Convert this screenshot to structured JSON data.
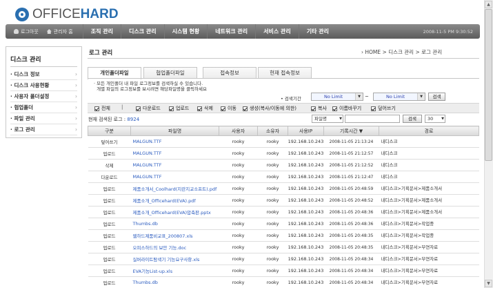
{
  "logo": {
    "part1": "OFFICE",
    "part2": "HARD"
  },
  "topnav": {
    "utils": [
      {
        "label": "로그아웃"
      },
      {
        "label": "관리자 홈"
      }
    ],
    "menu": [
      "조직 관리",
      "디스크 관리",
      "시스템 현황",
      "네트워크 관리",
      "서비스 관리",
      "기타 관리"
    ],
    "datetime": "2008-11-5 PM 9:30:52"
  },
  "sidebar": {
    "title": "디스크 관리",
    "items": [
      {
        "label": "· 디스크 정보",
        "arrow": "›"
      },
      {
        "label": "· 디스크 사용현황",
        "arrow": "›"
      },
      {
        "label": "· 사용자 폴더설정",
        "arrow": "›"
      },
      {
        "label": "· 협업폴더",
        "arrow": "›"
      },
      {
        "label": "· 파일 관리",
        "arrow": "›"
      },
      {
        "label": "· 로그 관리",
        "arrow": "›"
      }
    ]
  },
  "content": {
    "title": "로그 관리",
    "breadcrumb": "› HOME > 디스크 관리 > 로그 관리"
  },
  "tabs": [
    "개인폴더파일",
    "협업폴더파일",
    "접속정보",
    "현재 접속정보"
  ],
  "description": "· 모든 개인폴더 내 파일 로그정보를 검색하실 수 있습니다.\n  개별 파일의 로그정보를 보시려면 해당파일명을 클릭하세요",
  "period": {
    "label": "• 검색기간",
    "from": "No Limit",
    "tilde": "~",
    "to": "No Limit",
    "search_button": "검색"
  },
  "filters": {
    "all": "전체",
    "separator": "|",
    "items": [
      "다운로드",
      "업로드",
      "삭제",
      "이동",
      "생성(복사/이동에 의한)",
      "복사",
      "이름바꾸기",
      "덮어쓰기"
    ]
  },
  "results": {
    "count_label": "현재 검색된 로그 : ",
    "count_value": "8924",
    "filter_field": "파일명",
    "filter_field_arrow": "▼",
    "search_button": "검색",
    "page_size": "30",
    "page_size_arrow": "▼"
  },
  "table": {
    "headers": [
      "구분",
      "파일명",
      "사용자",
      "소유자",
      "사용IP",
      "기록시간 ▼",
      "경로"
    ],
    "rows": [
      [
        "덮어쓰기",
        "MALGUN.TTF",
        "rooky",
        "rooky",
        "192.168.10.243",
        "2008-11-05 21:13:24",
        "내디스크"
      ],
      [
        "업로드",
        "MALGUN.TTF",
        "rooky",
        "rooky",
        "192.168.10.243",
        "2008-11-05 21:12:57",
        "내디스크"
      ],
      [
        "삭제",
        "MALGUN.TTF",
        "rooky",
        "rooky",
        "192.168.10.243",
        "2008-11-05 21:12:52",
        "내디스크"
      ],
      [
        "다운로드",
        "MALGUN.TTF",
        "rooky",
        "rooky",
        "192.168.10.243",
        "2008-11-05 21:12:47",
        "내디스크"
      ],
      [
        "업로드",
        "제품소개서_Coolhard(지란지교소프트).pdf",
        "rooky",
        "rooky",
        "192.168.10.243",
        "2008-11-05 20:48:59",
        "내디스크>기획문서>제품소개서"
      ],
      [
        "업로드",
        "제품소개_Officehard(EVA).pdf",
        "rooky",
        "rooky",
        "192.168.10.243",
        "2008-11-05 20:48:52",
        "내디스크>기획문서>제품소개서"
      ],
      [
        "업로드",
        "제품소개_Officehard(EVA)압축판.pptx",
        "rooky",
        "rooky",
        "192.168.10.243",
        "2008-11-05 20:48:36",
        "내디스크>기획문서>제품소개서"
      ],
      [
        "업로드",
        "Thumbs.db",
        "rooky",
        "rooky",
        "192.168.10.243",
        "2008-11-05 20:48:36",
        "내디스크>기획문서>작업중"
      ],
      [
        "업로드",
        "웹하드제품비교표_200807.xls",
        "rooky",
        "rooky",
        "192.168.10.243",
        "2008-11-05 20:48:35",
        "내디스크>기획문서>작업중"
      ],
      [
        "업로드",
        "오피스하드의 보안 기능.doc",
        "rooky",
        "rooky",
        "192.168.10.243",
        "2008-11-05 20:48:35",
        "내디스크>기획문서>부연자료"
      ],
      [
        "업로드",
        "실버라이트탐색기 기능요구사항.xls",
        "rooky",
        "rooky",
        "192.168.10.243",
        "2008-11-05 20:48:34",
        "내디스크>기획문서>부연자료"
      ],
      [
        "업로드",
        "EVA기능List-up.xls",
        "rooky",
        "rooky",
        "192.168.10.243",
        "2008-11-05 20:48:34",
        "내디스크>기획문서>부연자료"
      ],
      [
        "업로드",
        "Thumbs.db",
        "rooky",
        "rooky",
        "192.168.10.243",
        "2008-11-05 20:48:34",
        "내디스크>기획문서>부연자료"
      ]
    ]
  }
}
